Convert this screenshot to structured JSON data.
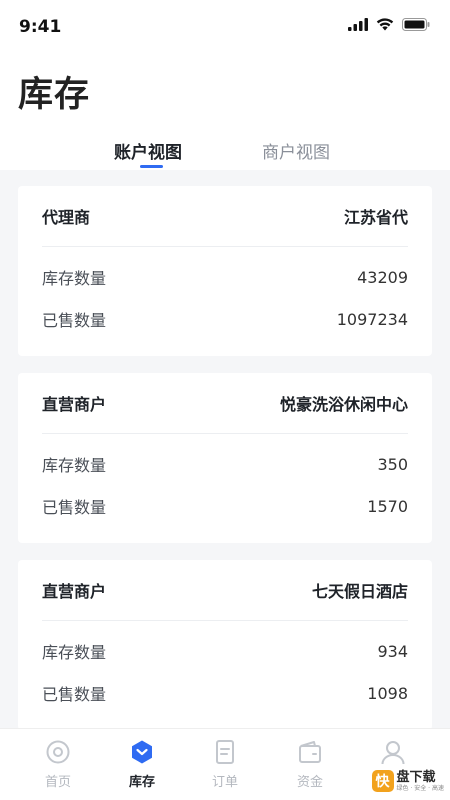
{
  "status_bar": {
    "time": "9:41"
  },
  "page": {
    "title": "库存"
  },
  "tabs": [
    {
      "label": "账户视图",
      "active": true
    },
    {
      "label": "商户视图",
      "active": false
    }
  ],
  "cards": [
    {
      "head_label": "代理商",
      "head_value": "江苏省代",
      "stats": [
        {
          "label": "库存数量",
          "value": "43209"
        },
        {
          "label": "已售数量",
          "value": "1097234"
        }
      ]
    },
    {
      "head_label": "直营商户",
      "head_value": "悦豪洗浴休闲中心",
      "stats": [
        {
          "label": "库存数量",
          "value": "350"
        },
        {
          "label": "已售数量",
          "value": "1570"
        }
      ]
    },
    {
      "head_label": "直营商户",
      "head_value": "七天假日酒店",
      "stats": [
        {
          "label": "库存数量",
          "value": "934"
        },
        {
          "label": "已售数量",
          "value": "1098"
        }
      ]
    }
  ],
  "tabbar": [
    {
      "label": "首页",
      "icon": "home-icon",
      "active": false
    },
    {
      "label": "库存",
      "icon": "inventory-icon",
      "active": true
    },
    {
      "label": "订单",
      "icon": "order-icon",
      "active": false
    },
    {
      "label": "资金",
      "icon": "wallet-icon",
      "active": false
    },
    {
      "label": "我的",
      "icon": "user-icon",
      "active": false
    }
  ],
  "watermark": {
    "badge": "快",
    "title": "盘下载",
    "subtitle": "绿色 · 安全 · 高速"
  },
  "colors": {
    "accent": "#2f6bf2",
    "inactive": "#b4b8bf",
    "watermark": "#f2a21d"
  }
}
